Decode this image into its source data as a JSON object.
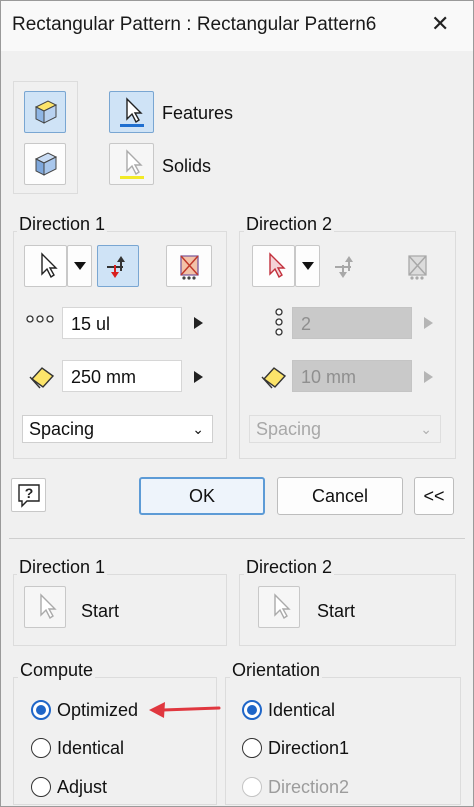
{
  "window": {
    "title": "Rectangular Pattern : Rectangular Pattern6",
    "close_glyph": "✕"
  },
  "top": {
    "features_label": "Features",
    "solids_label": "Solids"
  },
  "direction1": {
    "label": "Direction 1",
    "count": "15 ul",
    "spacing": "250 mm",
    "method": "Spacing"
  },
  "direction2": {
    "label": "Direction 2",
    "count": "2",
    "spacing": "10 mm",
    "method": "Spacing"
  },
  "buttons": {
    "ok": "OK",
    "cancel": "Cancel",
    "more": "<<",
    "help": "?"
  },
  "more_panel": {
    "direction1": {
      "label": "Direction 1",
      "start": "Start"
    },
    "direction2": {
      "label": "Direction 2",
      "start": "Start"
    }
  },
  "compute": {
    "label": "Compute",
    "options": [
      "Optimized",
      "Identical",
      "Adjust"
    ],
    "selected": "Optimized"
  },
  "orientation": {
    "label": "Orientation",
    "options": [
      "Identical",
      "Direction1",
      "Direction2"
    ],
    "selected": "Identical"
  },
  "colors": {
    "accent": "#1f66c8",
    "annotation_arrow": "#e0373f",
    "selected_bg": "#cfe3f6"
  }
}
